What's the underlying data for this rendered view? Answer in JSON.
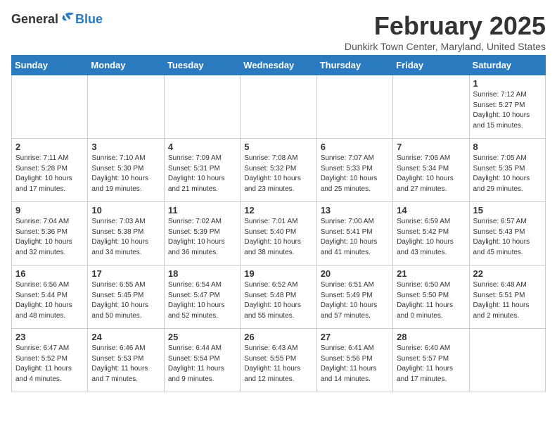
{
  "header": {
    "logo_general": "General",
    "logo_blue": "Blue",
    "month_title": "February 2025",
    "subtitle": "Dunkirk Town Center, Maryland, United States"
  },
  "weekdays": [
    "Sunday",
    "Monday",
    "Tuesday",
    "Wednesday",
    "Thursday",
    "Friday",
    "Saturday"
  ],
  "weeks": [
    [
      {
        "day": "",
        "info": ""
      },
      {
        "day": "",
        "info": ""
      },
      {
        "day": "",
        "info": ""
      },
      {
        "day": "",
        "info": ""
      },
      {
        "day": "",
        "info": ""
      },
      {
        "day": "",
        "info": ""
      },
      {
        "day": "1",
        "info": "Sunrise: 7:12 AM\nSunset: 5:27 PM\nDaylight: 10 hours\nand 15 minutes."
      }
    ],
    [
      {
        "day": "2",
        "info": "Sunrise: 7:11 AM\nSunset: 5:28 PM\nDaylight: 10 hours\nand 17 minutes."
      },
      {
        "day": "3",
        "info": "Sunrise: 7:10 AM\nSunset: 5:30 PM\nDaylight: 10 hours\nand 19 minutes."
      },
      {
        "day": "4",
        "info": "Sunrise: 7:09 AM\nSunset: 5:31 PM\nDaylight: 10 hours\nand 21 minutes."
      },
      {
        "day": "5",
        "info": "Sunrise: 7:08 AM\nSunset: 5:32 PM\nDaylight: 10 hours\nand 23 minutes."
      },
      {
        "day": "6",
        "info": "Sunrise: 7:07 AM\nSunset: 5:33 PM\nDaylight: 10 hours\nand 25 minutes."
      },
      {
        "day": "7",
        "info": "Sunrise: 7:06 AM\nSunset: 5:34 PM\nDaylight: 10 hours\nand 27 minutes."
      },
      {
        "day": "8",
        "info": "Sunrise: 7:05 AM\nSunset: 5:35 PM\nDaylight: 10 hours\nand 29 minutes."
      }
    ],
    [
      {
        "day": "9",
        "info": "Sunrise: 7:04 AM\nSunset: 5:36 PM\nDaylight: 10 hours\nand 32 minutes."
      },
      {
        "day": "10",
        "info": "Sunrise: 7:03 AM\nSunset: 5:38 PM\nDaylight: 10 hours\nand 34 minutes."
      },
      {
        "day": "11",
        "info": "Sunrise: 7:02 AM\nSunset: 5:39 PM\nDaylight: 10 hours\nand 36 minutes."
      },
      {
        "day": "12",
        "info": "Sunrise: 7:01 AM\nSunset: 5:40 PM\nDaylight: 10 hours\nand 38 minutes."
      },
      {
        "day": "13",
        "info": "Sunrise: 7:00 AM\nSunset: 5:41 PM\nDaylight: 10 hours\nand 41 minutes."
      },
      {
        "day": "14",
        "info": "Sunrise: 6:59 AM\nSunset: 5:42 PM\nDaylight: 10 hours\nand 43 minutes."
      },
      {
        "day": "15",
        "info": "Sunrise: 6:57 AM\nSunset: 5:43 PM\nDaylight: 10 hours\nand 45 minutes."
      }
    ],
    [
      {
        "day": "16",
        "info": "Sunrise: 6:56 AM\nSunset: 5:44 PM\nDaylight: 10 hours\nand 48 minutes."
      },
      {
        "day": "17",
        "info": "Sunrise: 6:55 AM\nSunset: 5:45 PM\nDaylight: 10 hours\nand 50 minutes."
      },
      {
        "day": "18",
        "info": "Sunrise: 6:54 AM\nSunset: 5:47 PM\nDaylight: 10 hours\nand 52 minutes."
      },
      {
        "day": "19",
        "info": "Sunrise: 6:52 AM\nSunset: 5:48 PM\nDaylight: 10 hours\nand 55 minutes."
      },
      {
        "day": "20",
        "info": "Sunrise: 6:51 AM\nSunset: 5:49 PM\nDaylight: 10 hours\nand 57 minutes."
      },
      {
        "day": "21",
        "info": "Sunrise: 6:50 AM\nSunset: 5:50 PM\nDaylight: 11 hours\nand 0 minutes."
      },
      {
        "day": "22",
        "info": "Sunrise: 6:48 AM\nSunset: 5:51 PM\nDaylight: 11 hours\nand 2 minutes."
      }
    ],
    [
      {
        "day": "23",
        "info": "Sunrise: 6:47 AM\nSunset: 5:52 PM\nDaylight: 11 hours\nand 4 minutes."
      },
      {
        "day": "24",
        "info": "Sunrise: 6:46 AM\nSunset: 5:53 PM\nDaylight: 11 hours\nand 7 minutes."
      },
      {
        "day": "25",
        "info": "Sunrise: 6:44 AM\nSunset: 5:54 PM\nDaylight: 11 hours\nand 9 minutes."
      },
      {
        "day": "26",
        "info": "Sunrise: 6:43 AM\nSunset: 5:55 PM\nDaylight: 11 hours\nand 12 minutes."
      },
      {
        "day": "27",
        "info": "Sunrise: 6:41 AM\nSunset: 5:56 PM\nDaylight: 11 hours\nand 14 minutes."
      },
      {
        "day": "28",
        "info": "Sunrise: 6:40 AM\nSunset: 5:57 PM\nDaylight: 11 hours\nand 17 minutes."
      },
      {
        "day": "",
        "info": ""
      }
    ]
  ]
}
